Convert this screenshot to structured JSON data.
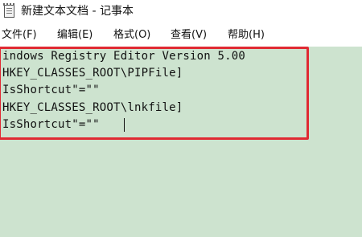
{
  "window": {
    "title": "新建文本文档 - 记事本",
    "icon": "notepad-icon"
  },
  "menu": [
    {
      "label": "文件(F)"
    },
    {
      "label": "编辑(E)"
    },
    {
      "label": "格式(O)"
    },
    {
      "label": "查看(V)"
    },
    {
      "label": "帮助(H)"
    }
  ],
  "editor": {
    "background": "#cde3cf",
    "lines": [
      "indows Registry Editor Version 5.00",
      "HKEY_CLASSES_ROOT\\PIPFile]",
      "IsShortcut\"=\"\"",
      "HKEY_CLASSES_ROOT\\lnkfile]",
      "IsShortcut\"=\"\""
    ]
  },
  "annotation": {
    "color": "#e02a33"
  }
}
